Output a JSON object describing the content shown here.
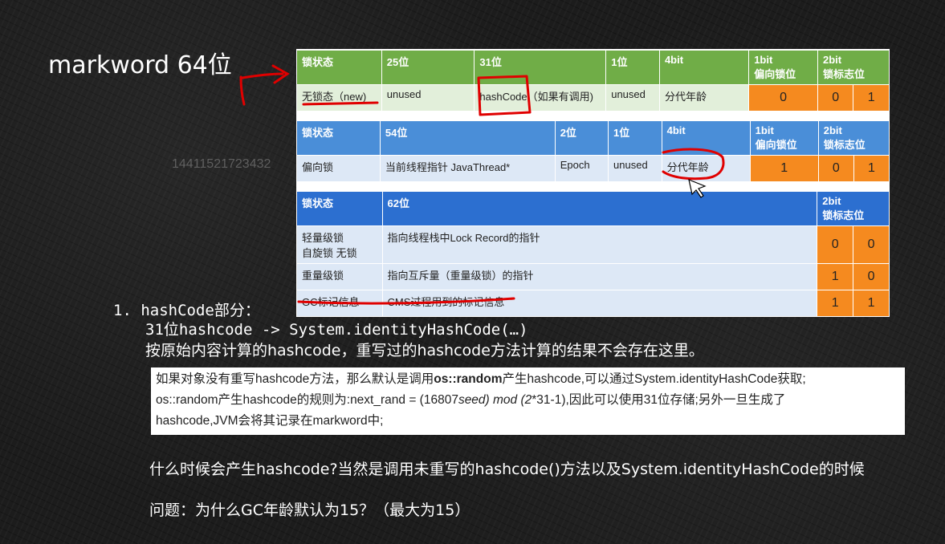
{
  "title": "markword 64位",
  "watermark": "14411521723432",
  "table1": {
    "headers": [
      "锁状态",
      "25位",
      "31位",
      "1位",
      "4bit",
      "1bit\n偏向锁位",
      "2bit\n锁标志位"
    ],
    "row": [
      "无锁态（new)",
      "unused",
      "hashCode（如果有调用)",
      "unused",
      "分代年龄",
      "0",
      "0",
      "1"
    ]
  },
  "table2": {
    "headers": [
      "锁状态",
      "54位",
      "2位",
      "1位",
      "4bit",
      "1bit\n偏向锁位",
      "2bit\n锁标志位"
    ],
    "row": [
      "偏向锁",
      "当前线程指针 JavaThread*",
      "Epoch",
      "unused",
      "分代年龄",
      "1",
      "0",
      "1"
    ]
  },
  "table3": {
    "headers": [
      "锁状态",
      "62位",
      "2bit\n锁标志位"
    ],
    "rows": [
      {
        "state": "轻量级锁\n自旋锁 无锁",
        "desc": "指向线程栈中Lock Record的指针",
        "b1": "0",
        "b2": "0"
      },
      {
        "state": "重量级锁",
        "desc": "指向互斥量（重量级锁）的指针",
        "b1": "1",
        "b2": "0"
      },
      {
        "state": "GC标记信息",
        "desc": "CMS过程用到的标记信息",
        "b1": "1",
        "b2": "1"
      }
    ]
  },
  "point1": {
    "line1": "1. hashCode部分：",
    "line2": "31位hashcode -> System.identityHashCode(…)",
    "line3": "按原始内容计算的hashcode，重写过的hashcode方法计算的结果不会存在这里。"
  },
  "note": {
    "part1": "如果对象没有重写hashcode方法，那么默认是调用",
    "bold": "os::random",
    "part2": "产生hashcode,可以通过System.identityHashCode获取;",
    "part3": "os::random产生hashcode的规则为:next_rand = (16807",
    "italic1": "seed) mod (2",
    "part4": "*31-1),因此可以使用31位存储;另外一旦生成了",
    "part5": "hashcode,JVM会将其记录在markword中;"
  },
  "question1": "什么时候会产生hashcode?当然是调用未重写的hashcode()方法以及System.identityHashCode的时候",
  "question2": "问题：为什么GC年龄默认为15？（最大为15）",
  "colors": {
    "green": "#70ad47",
    "blue": "#4a8ed8",
    "orange": "#f58a1f",
    "annotation": "#e00000"
  }
}
